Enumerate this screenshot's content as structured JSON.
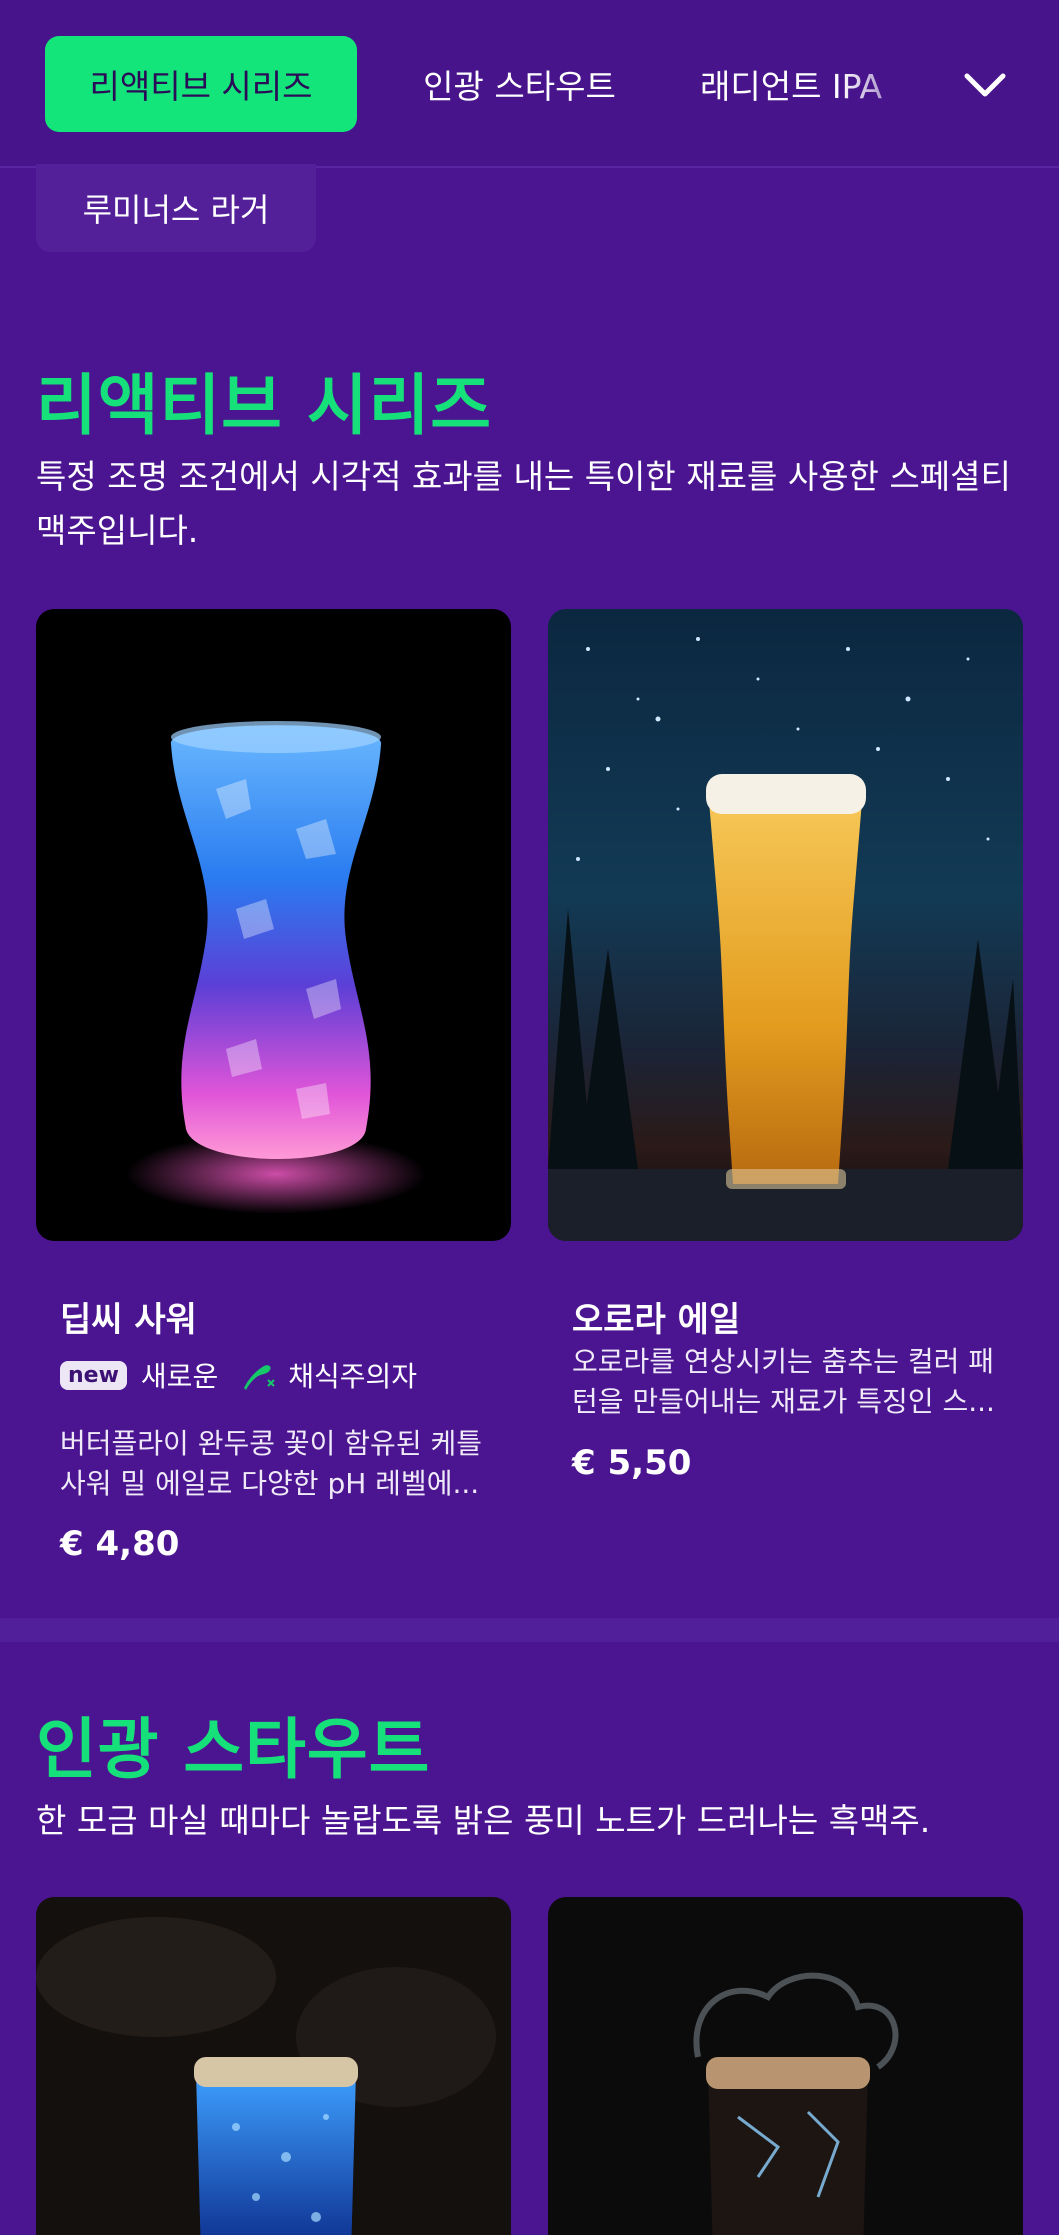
{
  "nav": {
    "tabs": [
      {
        "label": "리액티브 시리즈",
        "active": true
      },
      {
        "label": "인광 스타우트",
        "active": false
      },
      {
        "label": "래디언트 IPA",
        "active": false
      }
    ],
    "overflow_chip": "루미너스 라거",
    "expand_icon": "chevron-down-icon"
  },
  "sections": [
    {
      "title": "리액티브 시리즈",
      "description": "특정 조명 조건에서 시각적 효과를 내는 특이한 재료를 사용한 스페셜티 맥주입니다.",
      "products": [
        {
          "name": "딥씨 사워",
          "badge": "new",
          "badge_text": "새로운",
          "diet_icon": "vegetarian-icon",
          "diet_text": "채식주의자",
          "description": "버터플라이 완두콩 꽃이 함유된 케틀 사워 밀 에일로 다양한 pH 레벨에...",
          "price": "€ 4,80"
        },
        {
          "name": "오로라 에일",
          "description": "오로라를 연상시키는 춤추는 컬러 패턴을 만들어내는 재료가 특징인 스...",
          "price": "€ 5,50"
        }
      ]
    },
    {
      "title": "인광 스타우트",
      "description": "한 모금 마실 때마다 놀랍도록 밝은 풍미 노트가 드러나는 흑맥주."
    }
  ],
  "colors": {
    "background": "#4b1591",
    "accent_green": "#13e57a",
    "title_green": "#15e07a"
  }
}
